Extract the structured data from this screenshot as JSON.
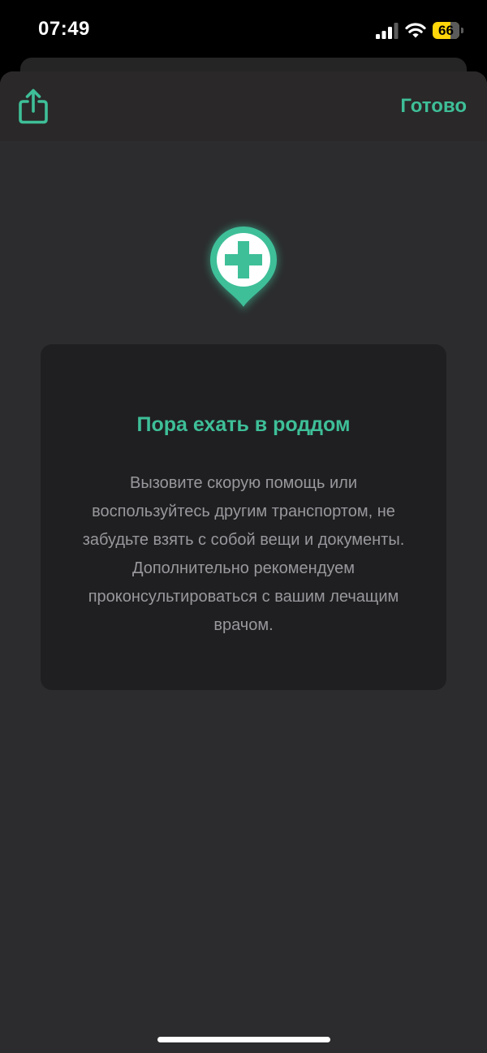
{
  "status_bar": {
    "time": "07:49",
    "battery_level": "66",
    "battery_fraction": 0.66,
    "signal_icon": "cellular-signal-icon",
    "wifi_icon": "wifi-icon"
  },
  "header": {
    "share_icon": "share-icon",
    "done_label": "Готово"
  },
  "card": {
    "icon": "medical-location-pin-icon",
    "title": "Пора ехать в роддом",
    "body": "Вызовите скорую помощь или воспользуйтесь другим транспортом, не забудьте взять с собой вещи и документы. Дополнительно рекомендуем проконсультироваться с вашим лечащим врачом."
  },
  "colors": {
    "accent": "#3ebf98",
    "background": "#2c2c2e",
    "card": "#1f1f21",
    "battery": "#ffd60a"
  }
}
